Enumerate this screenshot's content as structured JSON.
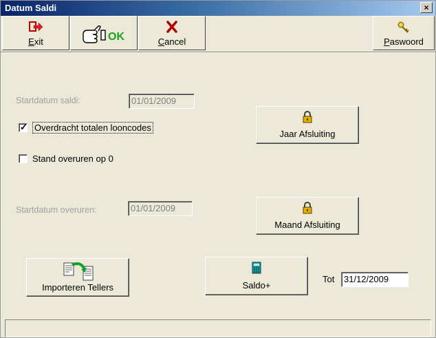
{
  "window": {
    "title": "Datum Saldi",
    "close_glyph": "×"
  },
  "toolbar": {
    "exit": {
      "label_u": "E",
      "label_rest": "xit",
      "icon": "exit-arrow-icon"
    },
    "ok": {
      "label": "OK",
      "icon": "hand-ok-icon"
    },
    "cancel": {
      "label_u": "C",
      "label_rest": "ancel",
      "icon": "red-x-icon"
    },
    "password": {
      "label_u": "P",
      "label_rest": "aswoord",
      "icon": "keys-icon"
    }
  },
  "form": {
    "startdatum_saldi": {
      "label": "Startdatum saldi:",
      "value": "01/01/2009"
    },
    "overdracht": {
      "label": "Overdracht totalen looncodes",
      "checked": true
    },
    "stand_overuren": {
      "label": "Stand overuren op 0",
      "checked": false
    },
    "startdatum_overuren": {
      "label": "Startdatum overuren:",
      "value": "01/01/2009"
    }
  },
  "buttons": {
    "jaar": {
      "label": "Jaar Afsluiting",
      "icon": "padlock-icon"
    },
    "maand": {
      "label": "Maand Afsluiting",
      "icon": "padlock-icon"
    },
    "importeren": {
      "label": "Importeren Tellers",
      "icon": "import-icon"
    },
    "saldo": {
      "label": "Saldo+",
      "icon": "calculator-icon"
    }
  },
  "tot": {
    "label": "Tot",
    "value": "31/12/2009"
  },
  "colors": {
    "face": "#ece9d8",
    "title_start": "#0a246a",
    "title_end": "#a6caf0"
  }
}
